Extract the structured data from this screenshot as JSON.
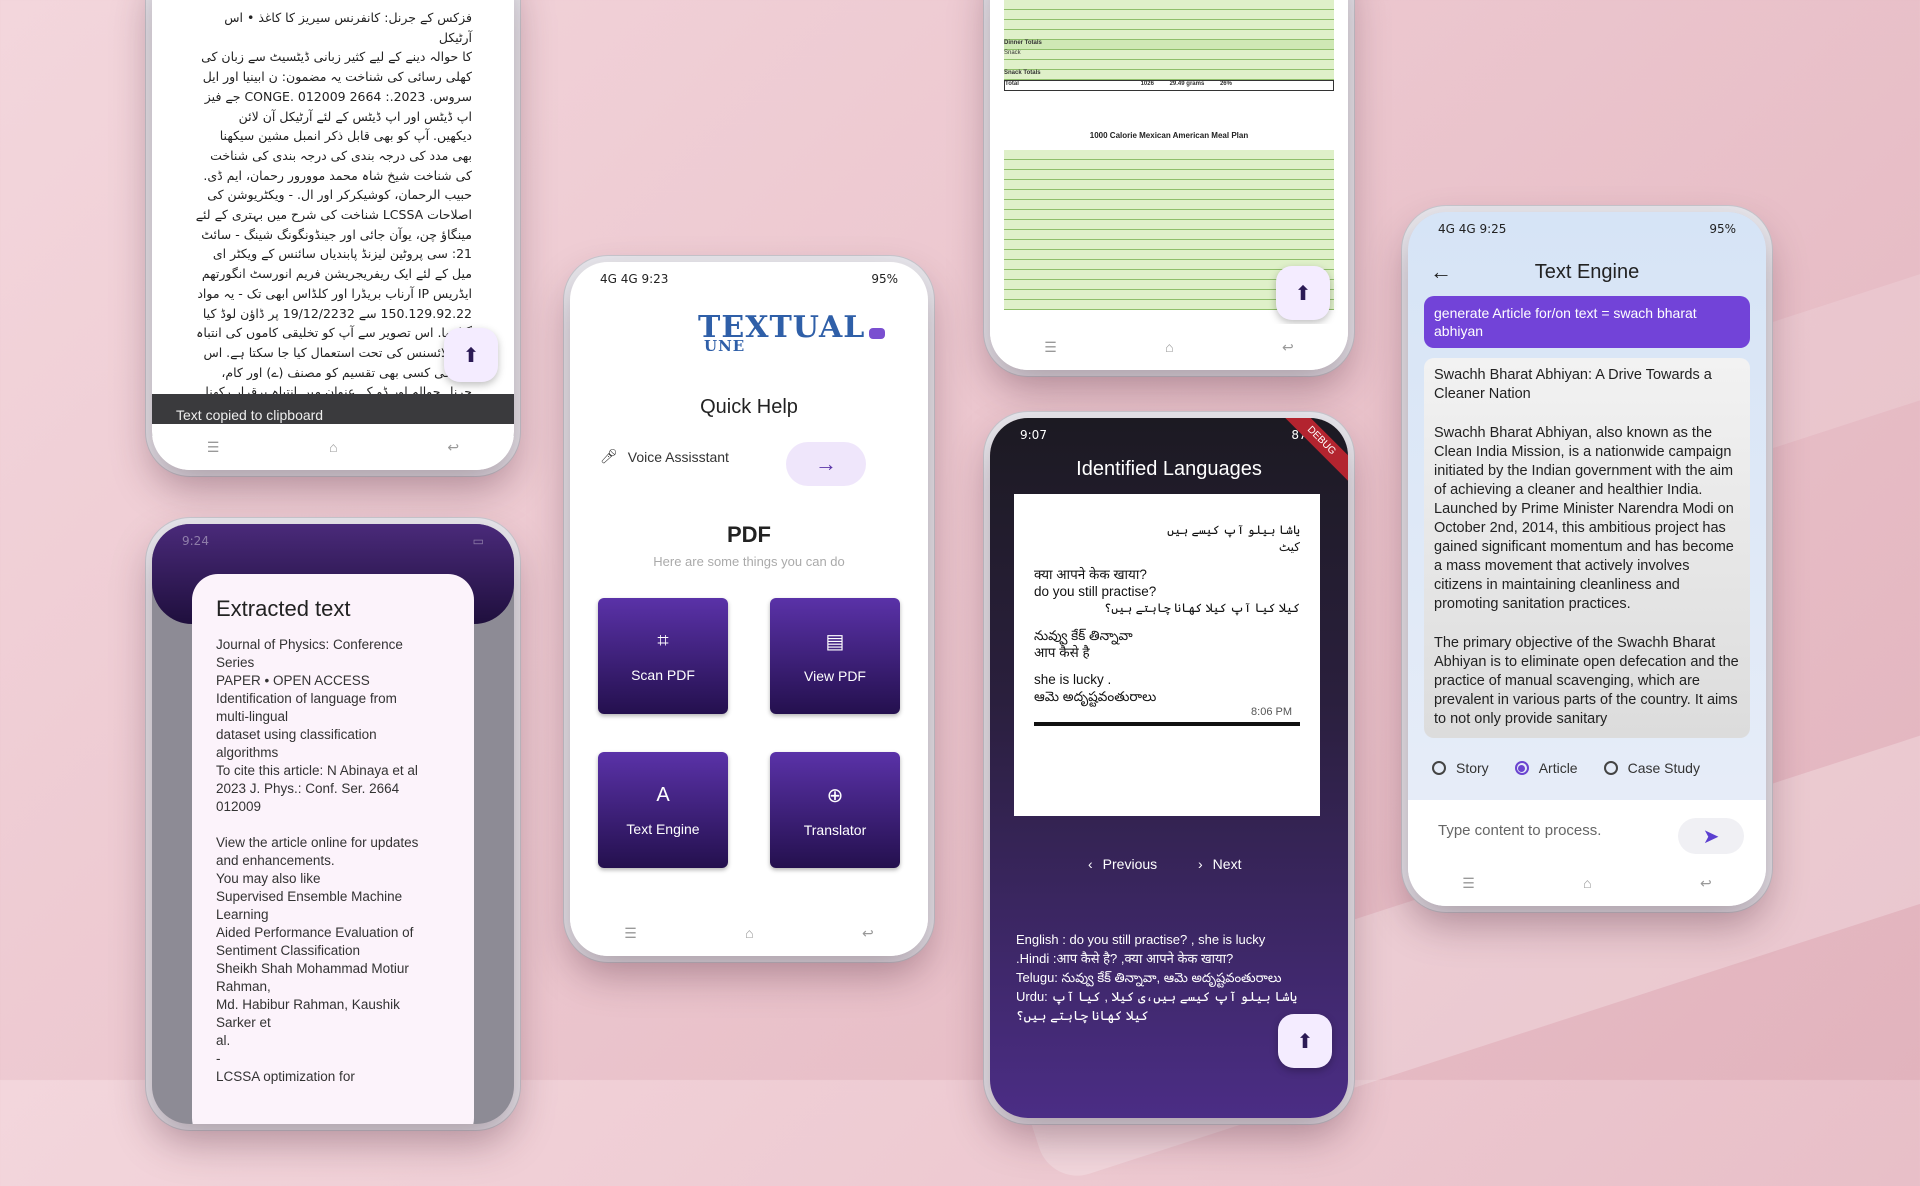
{
  "phone_urdu": {
    "lines": [
      "فزکس کے جرنل: کانفرنس سیریز کا کاغذ • اس آرٹیکل",
      "کا حوالہ دینے کے لیے کثیر زبانی ڈیٹسیٹ سے زبان کی",
      "کھلی رسائی کی شناخت یہ مضمون: ن ابینیا اور ایل",
      "سروس. 2023.: CONGE. 012009 2664 جے فیز",
      "اپ ڈیٹس اور اپ ڈیٹس کے لئے آرٹیکل آن لائن",
      "دیکھیں. آپ کو بھی قابل ذکر انمبل مشین سیکھنا",
      "بھی مدد کی درجہ بندی کی درجہ بندی کی شناخت",
      "کی شناخت شیخ شاہ محمد موورور رحمان، ایم ڈی.",
      "حبیب الرحمان، کوشیکرکر اور ال. - ویکٹریوشن کی",
      "اصلاحات LCSSA شناخت کی شرح میں بہتری کے لئے",
      "مینگاؤ چن، یوآن جائی اور جینڈونگونگ شینگ - سائٹ",
      "21: سی پروٹین لیزنڈ پابندیاں سائنس کے ویکٹر ای",
      "میل کے لئے ایک ریفریجریشن فریم انورسٹ انگورتھم",
      "ایڈریس IP آرناب بریڈرا اور کلڈاس ابھی تک - یہ مواد",
      "150.129.92.22 سے 19/12/2232 پر ڈاؤن لوڈ کیا",
      "گیا تھا. اس تصویر سے آپ کو تخلیقی کاموں کی انتباہ",
      "3.0 لائسنس کی تحت استعمال کیا جا سکتا ہے. اس",
      "کام کی کسی بھی تقسیم کو مصنف (ے) اور کام،",
      "جرنل حوالہ اور ڈو کے عنوان میں انتباہ برقرار رکھنا"
    ],
    "toast": "Text copied to clipboard",
    "fab_icon": "upload-icon"
  },
  "phone_extracted": {
    "status": "9:24",
    "title": "Extracted text",
    "body": "Journal of Physics: Conference\nSeries\nPAPER • OPEN ACCESS\nIdentification of language from\nmulti-lingual\ndataset using classification\nalgorithms\nTo cite this article: N Abinaya et al\n2023 J. Phys.: Conf. Ser. 2664\n012009\n\nView the article online for updates\nand enhancements.\nYou may also like\nSupervised Ensemble Machine\nLearning\nAided Performance Evaluation of\nSentiment Classification\nSheikh Shah Mohammad Motiur\nRahman,\nMd. Habibur Rahman, Kaushik\nSarker et\nal.\n-\nLCSSA optimization for"
  },
  "phone_quickhelp": {
    "status_left": "4G 4G 9:23",
    "status_right": "95%",
    "logo_top": "TEXTUAL",
    "logo_bottom": "UNE",
    "title": "Quick Help",
    "voice_label": "Voice Assisstant",
    "section_title": "PDF",
    "section_sub": "Here are some things you can do",
    "tiles": [
      {
        "label": "Scan PDF",
        "icon": "scan-icon"
      },
      {
        "label": "View PDF",
        "icon": "pdf-icon"
      },
      {
        "label": "Text Engine",
        "icon": "text-icon"
      },
      {
        "label": "Translator",
        "icon": "globe-icon"
      }
    ]
  },
  "phone_mealplan": {
    "heading": "1000 Calorie Mexican American Meal Plan",
    "top_labels": [
      "Dinner Totals",
      "Snack",
      "Snack Totals",
      "Total"
    ],
    "total_values": [
      "1026",
      "29.49 grams",
      "26%"
    ]
  },
  "phone_languages": {
    "status_left": "9:07",
    "status_right": "87%",
    "debug": "DEBUG",
    "title": "Identified Languages",
    "image_lines": [
      "یاشا بیلو آپ کیسے ہیں",
      "کیٹ",
      "क्या आपने केक खाया?",
      "do you still practise?",
      "کیلا  کیا آپ کیلا کھانا چاہتے ہیں؟",
      "నువ్వు కేక్ తిన్నావా",
      "आप कैसे है",
      "she is lucky .",
      "ఆమె అదృష్టవంతురాలు"
    ],
    "image_time": "8:06 PM",
    "prev_label": "Previous",
    "next_label": "Next",
    "results": [
      "English : do you still practise? , she is lucky",
      ".Hindi :आप कैसे है? ,क्या आपने केक खाया?",
      "Telugu: నువ్వు కేక్ తిన్నావా, ఆమె అదృష్టవంతురాలు",
      "Urdu: یاشا بیلو آپ کیسے ہیں،ی کیلا ,  کیا آپ کیلا کھانا چاہتے ہیں؟"
    ]
  },
  "phone_textengine": {
    "status_left": "4G 4G 9:25",
    "status_right": "95%",
    "title": "Text Engine",
    "prompt": "generate Article for/on text = swach bharat abhiyan",
    "paragraphs": [
      "Swachh Bharat Abhiyan: A Drive Towards a Cleaner Nation",
      "Swachh Bharat Abhiyan, also known as the Clean India Mission, is a nationwide campaign initiated by the Indian government with the aim of achieving a cleaner and healthier India. Launched by Prime Minister Narendra Modi on October 2nd, 2014, this ambitious project has gained significant momentum and has become a mass movement that actively involves citizens in maintaining cleanliness and promoting sanitation practices.",
      "The primary objective of the Swachh Bharat Abhiyan is to eliminate open defecation and the practice of manual scavenging, which are prevalent in various parts of the country. It aims to not only provide sanitary"
    ],
    "options": [
      "Story",
      "Article",
      "Case Study"
    ],
    "selected": "Article",
    "input_placeholder": "Type content to process."
  }
}
